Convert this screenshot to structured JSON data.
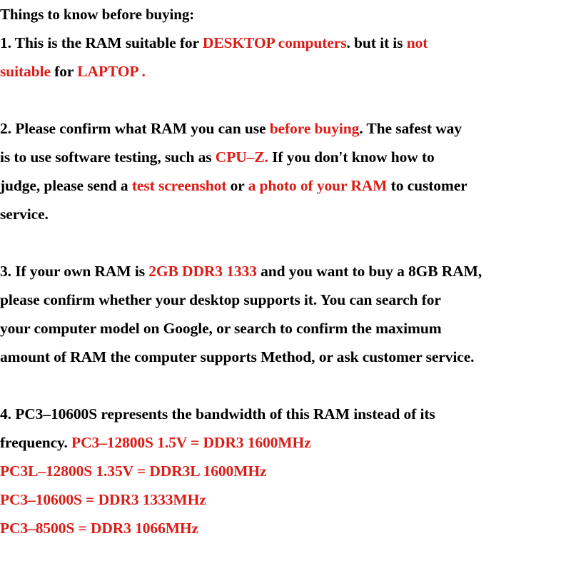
{
  "document": {
    "title": "Things to know before buying:",
    "accent_color": "#dc1c16",
    "text_color": "#000000",
    "background_color": "#ffffff"
  },
  "lines": [
    {
      "id": "heading",
      "kind": "heading",
      "segments": [
        {
          "text": "Things to know before buying:",
          "color": "black"
        }
      ]
    },
    {
      "id": "item1-line1",
      "kind": "body",
      "segments": [
        {
          "text": "1. This is the RAM suitable for ",
          "color": "black"
        },
        {
          "text": "DESKTOP computers",
          "color": "red"
        },
        {
          "text": ". but it is ",
          "color": "black"
        },
        {
          "text": "not",
          "color": "red"
        }
      ]
    },
    {
      "id": "item1-line2",
      "kind": "body",
      "segments": [
        {
          "text": "suitable",
          "color": "red"
        },
        {
          "text": " for ",
          "color": "black"
        },
        {
          "text": "LAPTOP .",
          "color": "red"
        }
      ]
    },
    {
      "id": "gap1",
      "kind": "blank",
      "segments": []
    },
    {
      "id": "item2-line1",
      "kind": "body",
      "segments": [
        {
          "text": "2. Please confirm what RAM you can use ",
          "color": "black"
        },
        {
          "text": "before buying",
          "color": "red"
        },
        {
          "text": ". The safest way",
          "color": "black"
        }
      ]
    },
    {
      "id": "item2-line2",
      "kind": "body",
      "segments": [
        {
          "text": "is to use software testing, such as ",
          "color": "black"
        },
        {
          "text": "CPU–Z.",
          "color": "red"
        },
        {
          "text": " If you don't know how to",
          "color": "black"
        }
      ]
    },
    {
      "id": "item2-line3",
      "kind": "body",
      "segments": [
        {
          "text": "judge, please send a ",
          "color": "black"
        },
        {
          "text": "test screenshot",
          "color": "red"
        },
        {
          "text": " or ",
          "color": "black"
        },
        {
          "text": "a photo of your RAM",
          "color": "red"
        },
        {
          "text": " to customer",
          "color": "black"
        }
      ]
    },
    {
      "id": "item2-line4",
      "kind": "body",
      "segments": [
        {
          "text": "service.",
          "color": "black"
        }
      ]
    },
    {
      "id": "gap2",
      "kind": "blank",
      "segments": []
    },
    {
      "id": "item3-line1",
      "kind": "body",
      "segments": [
        {
          "text": "3. If your own RAM is ",
          "color": "black"
        },
        {
          "text": "2GB DDR3 1333",
          "color": "red"
        },
        {
          "text": " and you want to buy a 8GB RAM,",
          "color": "black"
        }
      ]
    },
    {
      "id": "item3-line2",
      "kind": "body",
      "segments": [
        {
          "text": "please confirm whether your desktop supports it. You can search for",
          "color": "black"
        }
      ]
    },
    {
      "id": "item3-line3",
      "kind": "body",
      "segments": [
        {
          "text": "your computer model on Google, or search to confirm the maximum",
          "color": "black"
        }
      ]
    },
    {
      "id": "item3-line4",
      "kind": "body",
      "segments": [
        {
          "text": "amount of RAM the computer supports Method, or ask customer service.",
          "color": "black"
        }
      ]
    },
    {
      "id": "gap3",
      "kind": "blank",
      "segments": []
    },
    {
      "id": "item4-line1",
      "kind": "body",
      "segments": [
        {
          "text": "4. PC3–10600S represents the bandwidth of this RAM instead of its",
          "color": "black"
        }
      ]
    },
    {
      "id": "item4-line2",
      "kind": "body",
      "segments": [
        {
          "text": "frequency. ",
          "color": "black"
        },
        {
          "text": "PC3–12800S 1.5V = DDR3 1600MHz",
          "color": "red"
        }
      ]
    },
    {
      "id": "item4-line3",
      "kind": "body",
      "segments": [
        {
          "text": "PC3L–12800S 1.35V = DDR3L 1600MHz",
          "color": "red"
        }
      ]
    },
    {
      "id": "item4-line4",
      "kind": "body",
      "segments": [
        {
          "text": "PC3–10600S = DDR3 1333MHz",
          "color": "red"
        }
      ]
    },
    {
      "id": "item4-line5",
      "kind": "body",
      "segments": [
        {
          "text": "PC3–8500S = DDR3 1066MHz",
          "color": "red"
        }
      ]
    }
  ]
}
